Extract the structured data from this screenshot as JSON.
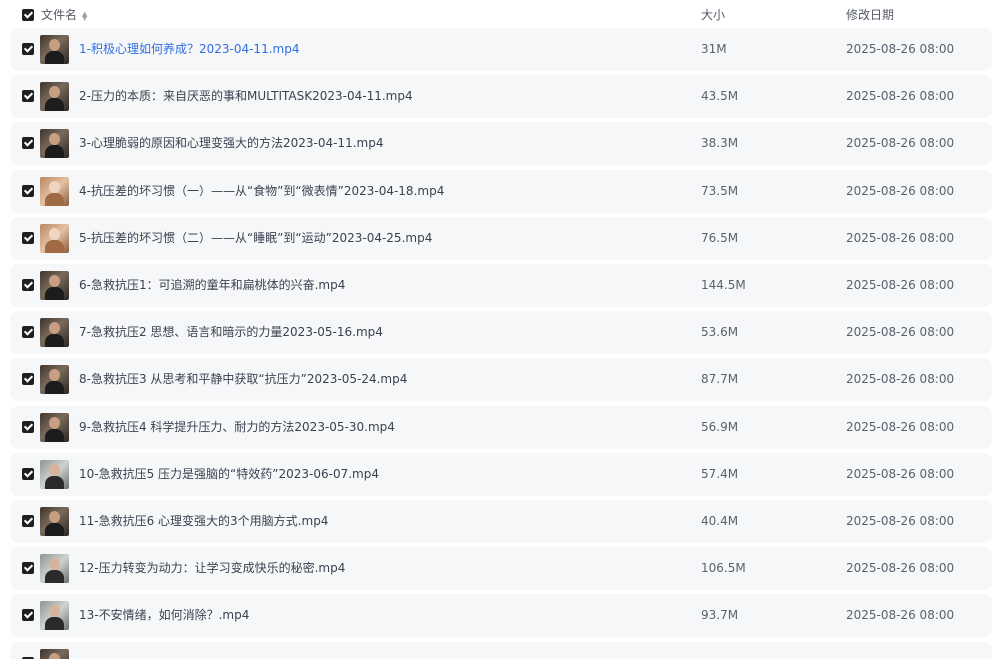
{
  "header": {
    "name_label": "文件名",
    "size_label": "大小",
    "date_label": "修改日期",
    "sort_icon": "sort-updown-icon"
  },
  "files": [
    {
      "name": "1-积极心理如何养成？2023-04-11.mp4",
      "size": "31M",
      "date": "2025-08-26 08:00",
      "thumb": "dark"
    },
    {
      "name": "2-压力的本质：来自厌恶的事和MULTITASK2023-04-11.mp4",
      "size": "43.5M",
      "date": "2025-08-26 08:00",
      "thumb": "dark"
    },
    {
      "name": "3-心理脆弱的原因和心理变强大的方法2023-04-11.mp4",
      "size": "38.3M",
      "date": "2025-08-26 08:00",
      "thumb": "dark"
    },
    {
      "name": "4-抗压差的坏习惯（一）——从“食物”到“微表情”2023-04-18.mp4",
      "size": "73.5M",
      "date": "2025-08-26 08:00",
      "thumb": "warm"
    },
    {
      "name": "5-抗压差的坏习惯（二）——从“睡眠”到“运动”2023-04-25.mp4",
      "size": "76.5M",
      "date": "2025-08-26 08:00",
      "thumb": "warm"
    },
    {
      "name": "6-急救抗压1：可追溯的童年和扁桃体的兴奋.mp4",
      "size": "144.5M",
      "date": "2025-08-26 08:00",
      "thumb": "dark"
    },
    {
      "name": "7-急救抗压2 思想、语言和暗示的力量2023-05-16.mp4",
      "size": "53.6M",
      "date": "2025-08-26 08:00",
      "thumb": "dark"
    },
    {
      "name": "8-急救抗压3 从思考和平静中获取“抗压力”2023-05-24.mp4",
      "size": "87.7M",
      "date": "2025-08-26 08:00",
      "thumb": "dark"
    },
    {
      "name": "9-急救抗压4 科学提升压力、耐力的方法2023-05-30.mp4",
      "size": "56.9M",
      "date": "2025-08-26 08:00",
      "thumb": "dark"
    },
    {
      "name": "10-急救抗压5 压力是强脑的“特效药”2023-06-07.mp4",
      "size": "57.4M",
      "date": "2025-08-26 08:00",
      "thumb": "light"
    },
    {
      "name": "11-急救抗压6 心理变强大的3个用脑方式.mp4",
      "size": "40.4M",
      "date": "2025-08-26 08:00",
      "thumb": "dark"
    },
    {
      "name": "12-压力转变为动力：让学习变成快乐的秘密.mp4",
      "size": "106.5M",
      "date": "2025-08-26 08:00",
      "thumb": "light"
    },
    {
      "name": "13-不安情绪，如何消除？.mp4",
      "size": "93.7M",
      "date": "2025-08-26 08:00",
      "thumb": "light"
    },
    {
      "name": "",
      "size": "",
      "date": "",
      "thumb": "dark"
    }
  ]
}
